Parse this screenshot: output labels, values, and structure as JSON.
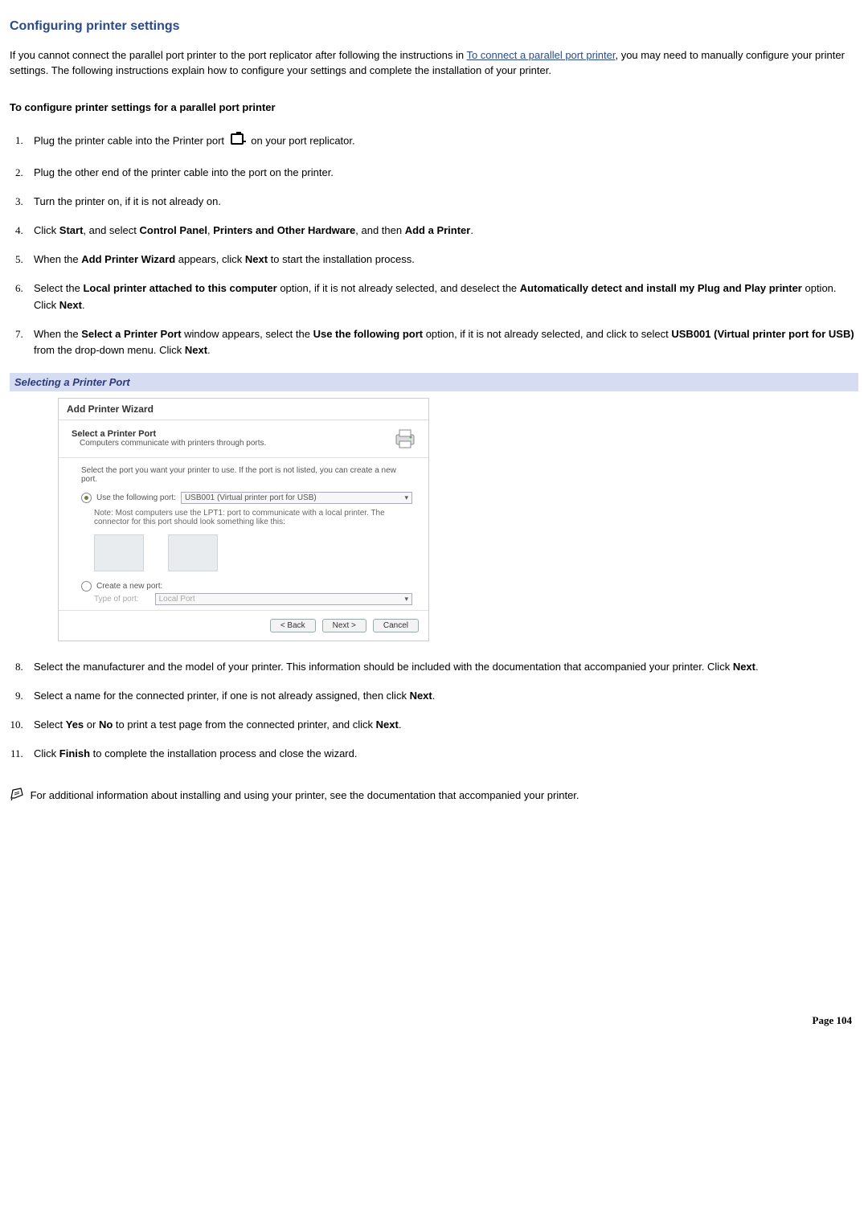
{
  "title": "Configuring printer settings",
  "intro_pre": "If you cannot connect the parallel port printer to the port replicator after following the instructions in ",
  "intro_link": "To connect a parallel port printer",
  "intro_post": ", you may need to manually configure your printer settings. The following instructions explain how to configure your settings and complete the installation of your printer.",
  "subheading": "To configure printer settings for a parallel port printer",
  "steps": {
    "s1_pre": "Plug the printer cable into the Printer port ",
    "s1_post": " on your port replicator.",
    "s2": "Plug the other end of the printer cable into the port on the printer.",
    "s3": "Turn the printer on, if it is not already on.",
    "s4_pre": "Click ",
    "s4_b1": "Start",
    "s4_mid1": ", and select ",
    "s4_b2": "Control Panel",
    "s4_mid2": ", ",
    "s4_b3": "Printers and Other Hardware",
    "s4_mid3": ", and then ",
    "s4_b4": "Add a Printer",
    "s4_end": ".",
    "s5_pre": "When the ",
    "s5_b1": "Add Printer Wizard",
    "s5_mid": " appears, click ",
    "s5_b2": "Next",
    "s5_end": " to start the installation process.",
    "s6_pre": "Select the ",
    "s6_b1": "Local printer attached to this computer",
    "s6_mid": " option, if it is not already selected, and deselect the ",
    "s6_b2": "Automatically detect and install my Plug and Play printer",
    "s6_mid2": " option. Click ",
    "s6_b3": "Next",
    "s6_end": ".",
    "s7_pre": "When the ",
    "s7_b1": "Select a Printer Port",
    "s7_mid1": " window appears, select the ",
    "s7_b2": "Use the following port",
    "s7_mid2": " option, if it is not already selected, and click to select ",
    "s7_b3": "USB001 (Virtual printer port for USB)",
    "s7_mid3": " from the drop-down menu. Click ",
    "s7_b4": "Next",
    "s7_end": ".",
    "s8_pre": "Select the manufacturer and the model of your printer. This information should be included with the documentation that accompanied your printer. Click ",
    "s8_b1": "Next",
    "s8_end": ".",
    "s9_pre": "Select a name for the connected printer, if one is not already assigned, then click ",
    "s9_b1": "Next",
    "s9_end": ".",
    "s10_pre": "Select ",
    "s10_b1": "Yes",
    "s10_mid1": " or ",
    "s10_b2": "No",
    "s10_mid2": " to print a test page from the connected printer, and click ",
    "s10_b3": "Next",
    "s10_end": ".",
    "s11_pre": "Click ",
    "s11_b1": "Finish",
    "s11_end": " to complete the installation process and close the wizard."
  },
  "banner": "Selecting a Printer Port",
  "wizard": {
    "titlebar": "Add Printer Wizard",
    "header_title": "Select a Printer Port",
    "header_sub": "Computers communicate with printers through ports.",
    "body_desc": "Select the port you want your printer to use. If the port is not listed, you can create a new port.",
    "radio1": "Use the following port:",
    "dropdown1": "USB001 (Virtual printer port for USB)",
    "note": "Note: Most computers use the LPT1: port to communicate with a local printer. The connector for this port should look something like this:",
    "radio2": "Create a new port:",
    "type_label": "Type of port:",
    "dropdown2": "Local Port",
    "back": "< Back",
    "next": "Next >",
    "cancel": "Cancel"
  },
  "footnote": " For additional information about installing and using your printer, see the documentation that accompanied your printer.",
  "page_number": "Page 104"
}
